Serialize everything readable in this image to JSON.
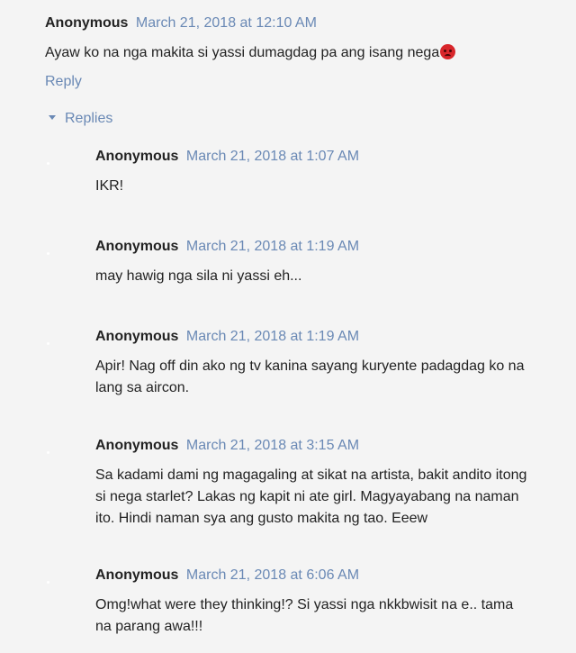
{
  "top_comment": {
    "author": "Anonymous",
    "date": "March 21, 2018 at 12:10 AM",
    "text": "Ayaw ko na nga makita si yassi dumagdag pa ang isang nega",
    "emoji": "angry-face-icon",
    "reply_label": "Reply"
  },
  "replies_toggle": {
    "label": "Replies"
  },
  "replies": [
    {
      "author": "Anonymous",
      "date": "March 21, 2018 at 1:07 AM",
      "text": "IKR!"
    },
    {
      "author": "Anonymous",
      "date": "March 21, 2018 at 1:19 AM",
      "text": "may hawig nga sila ni yassi eh..."
    },
    {
      "author": "Anonymous",
      "date": "March 21, 2018 at 1:19 AM",
      "text": "Apir! Nag off din ako ng tv kanina sayang kuryente padagdag ko na lang sa aircon."
    },
    {
      "author": "Anonymous",
      "date": "March 21, 2018 at 3:15 AM",
      "text": "Sa kadami dami ng magagaling at sikat na artista, bakit andito itong si nega starlet? Lakas ng kapit ni ate girl. Magyayabang na naman ito. Hindi naman sya ang gusto makita ng tao. Eeew"
    },
    {
      "author": "Anonymous",
      "date": "March 21, 2018 at 6:06 AM",
      "text": "Omg!what were they thinking!? Si yassi nga nkkbwisit na e.. tama na parang awa!!!"
    }
  ],
  "colors": {
    "background": "#f4f4f4",
    "link": "#6a89b5",
    "text": "#222222"
  }
}
